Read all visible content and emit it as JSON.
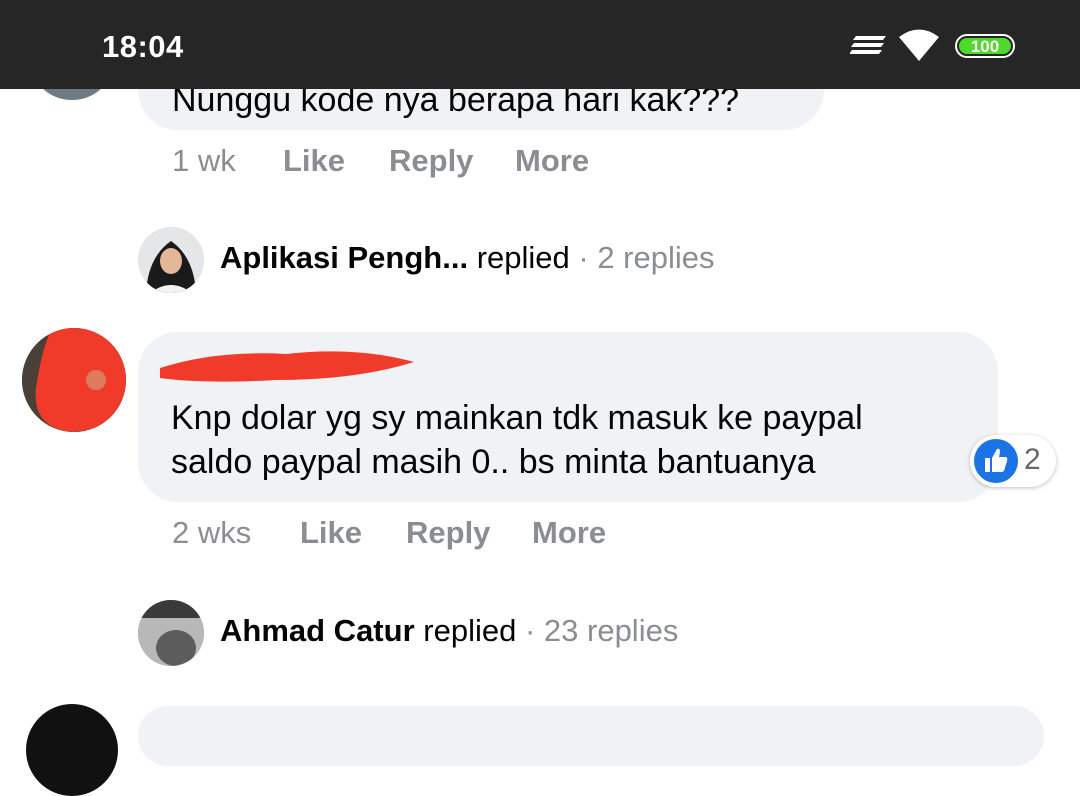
{
  "status_bar": {
    "time": "18:04",
    "battery": "100"
  },
  "comments": [
    {
      "text": "Nunggu kode nya berapa hari kak???",
      "time": "1 wk",
      "like_label": "Like",
      "reply_label": "Reply",
      "more_label": "More",
      "replies": {
        "name": "Aplikasi Pengh...",
        "verb": "replied",
        "separator": "·",
        "count": "2 replies"
      }
    },
    {
      "line1": "Knp dolar yg sy mainkan tdk masuk ke paypal",
      "line2": "saldo paypal masih 0.. bs minta bantuanya",
      "reaction_count": "2",
      "time": "2 wks",
      "like_label": "Like",
      "reply_label": "Reply",
      "more_label": "More",
      "replies": {
        "name": "Ahmad Catur",
        "verb": "replied",
        "separator": "·",
        "count": "23 replies"
      }
    }
  ],
  "icons": {
    "signal": "signal-icon",
    "wifi": "wifi-icon",
    "battery": "battery-icon",
    "like": "like-icon"
  }
}
